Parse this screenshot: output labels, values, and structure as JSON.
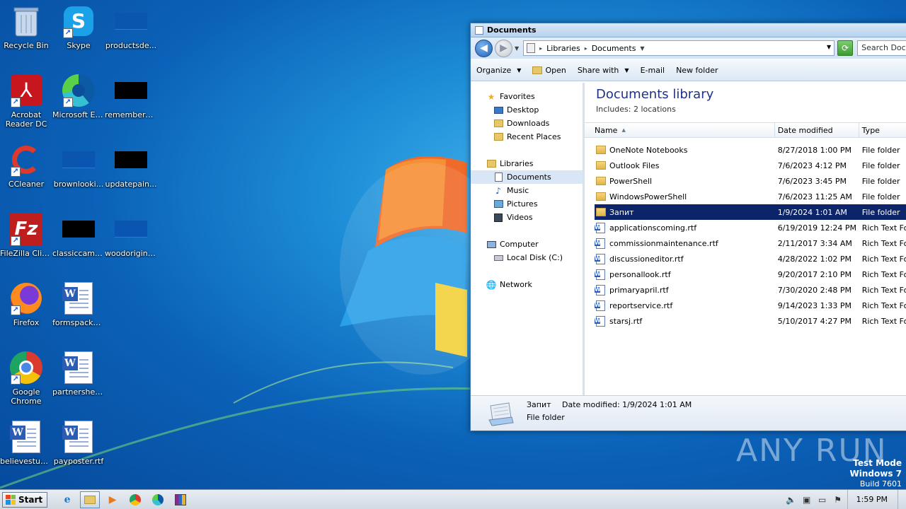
{
  "desktop": {
    "icons": [
      {
        "label": "Recycle Bin",
        "name": "recycle-bin-icon"
      },
      {
        "label": "Skype",
        "name": "skype-icon"
      },
      {
        "label": "productsde...",
        "name": "file-icon"
      },
      {
        "label": "Acrobat Reader DC",
        "name": "acrobat-icon"
      },
      {
        "label": "Microsoft Edge",
        "name": "edge-icon"
      },
      {
        "label": "rememberd...",
        "name": "file-icon"
      },
      {
        "label": "CCleaner",
        "name": "ccleaner-icon"
      },
      {
        "label": "brownlooki...",
        "name": "file-icon"
      },
      {
        "label": "updatepain...",
        "name": "file-icon"
      },
      {
        "label": "FileZilla Client",
        "name": "filezilla-icon"
      },
      {
        "label": "classiccame...",
        "name": "file-icon"
      },
      {
        "label": "woodorigina...",
        "name": "file-icon"
      },
      {
        "label": "Firefox",
        "name": "firefox-icon"
      },
      {
        "label": "formspacka...",
        "name": "word-doc-icon"
      },
      {
        "label": "Google Chrome",
        "name": "chrome-icon"
      },
      {
        "label": "partnershea...",
        "name": "word-doc-icon"
      },
      {
        "label": "believestud...",
        "name": "word-doc-icon"
      },
      {
        "label": "payposter.rtf",
        "name": "word-doc-icon"
      }
    ],
    "colors": {
      "accent": "#0b62b8",
      "selection": "#0b246a"
    }
  },
  "explorer": {
    "title": "Documents",
    "address": {
      "crumbs": [
        "Libraries",
        "Documents"
      ]
    },
    "search_placeholder": "Search Documents",
    "toolbar": {
      "organize": "Organize",
      "open": "Open",
      "share_with": "Share with",
      "email": "E-mail",
      "new_folder": "New folder"
    },
    "nav": {
      "favorites": "Favorites",
      "desktop": "Desktop",
      "downloads": "Downloads",
      "recent": "Recent Places",
      "libraries": "Libraries",
      "documents": "Documents",
      "music": "Music",
      "pictures": "Pictures",
      "videos": "Videos",
      "computer": "Computer",
      "local_disk": "Local Disk (C:)",
      "network": "Network"
    },
    "library_title": "Documents library",
    "library_sub": "Includes:  2 locations",
    "columns": {
      "name": "Name",
      "date": "Date modified",
      "type": "Type"
    },
    "files": [
      {
        "name": "OneNote Notebooks",
        "date": "8/27/2018 1:00 PM",
        "type": "File folder",
        "kind": "folder"
      },
      {
        "name": "Outlook Files",
        "date": "7/6/2023 4:12 PM",
        "type": "File folder",
        "kind": "folder"
      },
      {
        "name": "PowerShell",
        "date": "7/6/2023 3:45 PM",
        "type": "File folder",
        "kind": "folder"
      },
      {
        "name": "WindowsPowerShell",
        "date": "7/6/2023 11:25 AM",
        "type": "File folder",
        "kind": "folder"
      },
      {
        "name": "Запит",
        "date": "1/9/2024 1:01 AM",
        "type": "File folder",
        "kind": "folder",
        "selected": true
      },
      {
        "name": "applicationscoming.rtf",
        "date": "6/19/2019 12:24 PM",
        "type": "Rich Text Fo",
        "kind": "rtf"
      },
      {
        "name": "commissionmaintenance.rtf",
        "date": "2/11/2017 3:34 AM",
        "type": "Rich Text Fo",
        "kind": "rtf"
      },
      {
        "name": "discussioneditor.rtf",
        "date": "4/28/2022 1:02 PM",
        "type": "Rich Text Fo",
        "kind": "rtf"
      },
      {
        "name": "personallook.rtf",
        "date": "9/20/2017 2:10 PM",
        "type": "Rich Text Fo",
        "kind": "rtf"
      },
      {
        "name": "primaryapril.rtf",
        "date": "7/30/2020 2:48 PM",
        "type": "Rich Text Fo",
        "kind": "rtf"
      },
      {
        "name": "reportservice.rtf",
        "date": "9/14/2023 1:33 PM",
        "type": "Rich Text Fo",
        "kind": "rtf"
      },
      {
        "name": "starsj.rtf",
        "date": "5/10/2017 4:27 PM",
        "type": "Rich Text Fo",
        "kind": "rtf"
      }
    ],
    "details": {
      "name": "Запит",
      "date_modified": "Date modified: 1/9/2024 1:01 AM",
      "type": "File folder"
    }
  },
  "watermark": "ANY RUN",
  "test_mode": {
    "line1": "Test Mode",
    "line2": "Windows 7",
    "line3": "Build 7601"
  },
  "taskbar": {
    "start": "Start",
    "clock": "1:59 PM"
  }
}
